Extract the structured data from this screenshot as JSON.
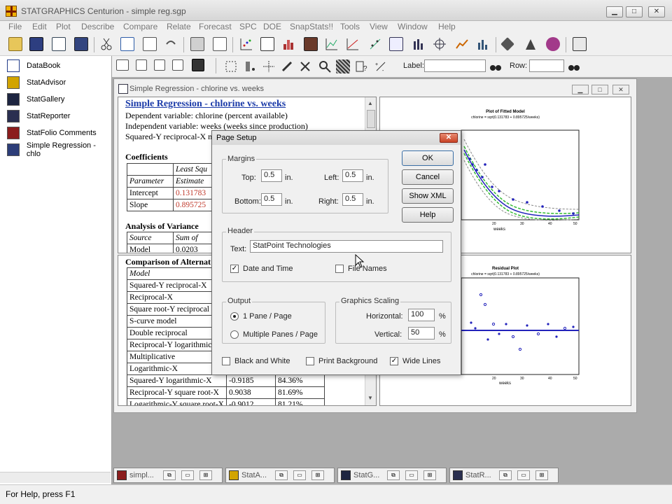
{
  "app": {
    "title": "STATGRAPHICS Centurion - simple reg.sgp"
  },
  "window_buttons": {
    "minimize": "▁",
    "maximize": "□",
    "close": "✕"
  },
  "menu": [
    "File",
    "Edit",
    "Plot",
    "Describe",
    "Compare",
    "Relate",
    "Forecast",
    "SPC",
    "DOE",
    "SnapStats!!",
    "Tools",
    "View",
    "Window",
    "Help"
  ],
  "toolbar2": {
    "label_text": "Label:",
    "label_value": "",
    "row_text": "Row:",
    "row_value": ""
  },
  "left_panel": {
    "items": [
      "DataBook",
      "StatAdvisor",
      "StatGallery",
      "StatReporter",
      "StatFolio Comments",
      "Simple Regression - chlo"
    ]
  },
  "child_window": {
    "title": "Simple Regression - chlorine vs. weeks"
  },
  "report": {
    "heading": "Simple Regression - chlorine vs. weeks",
    "lines": [
      "Dependent variable: chlorine (percent available)",
      "Independent variable: weeks (weeks since production)",
      "Squared-Y reciprocal-X m"
    ],
    "coefficients_title": "Coefficients",
    "coef_header1": [
      "",
      "Least Squ"
    ],
    "coef_header2": [
      "Parameter",
      "Estimate"
    ],
    "coef_rows": [
      [
        "Intercept",
        "0.131783"
      ],
      [
        "Slope",
        "0.895725"
      ]
    ],
    "anova_title": "Analysis of Variance",
    "anova_header": [
      "Source",
      "Sum of"
    ],
    "anova_rows": [
      [
        "Model",
        "0.0203"
      ]
    ]
  },
  "comparison": {
    "title": "Comparison of Alternat",
    "header": "Model",
    "rows": [
      [
        "Squared-Y reciprocal-X",
        "",
        ""
      ],
      [
        "Reciprocal-X",
        "",
        ""
      ],
      [
        "Square root-Y reciprocal",
        "",
        ""
      ],
      [
        "S-curve model",
        "",
        ""
      ],
      [
        "Double reciprocal",
        "",
        ""
      ],
      [
        "Reciprocal-Y logarithmic",
        "",
        ""
      ],
      [
        "Multiplicative",
        "",
        ""
      ],
      [
        "Logarithmic-X",
        "",
        ""
      ],
      [
        "Squared-Y logarithmic-X",
        "-0.9185",
        "84.36%"
      ],
      [
        "Reciprocal-Y square root-X",
        "0.9038",
        "81.69%"
      ],
      [
        "Logarithmic-Y square root-X",
        "-0.9012",
        "81.21%"
      ]
    ]
  },
  "graph1": {
    "title": "Plot of Fitted Model",
    "subtitle": "chlorine = sqrt(0.131783 + 0.895725/weeks)",
    "xlabel": "weeks"
  },
  "graph2": {
    "title": "Residual Plot",
    "subtitle": "chlorine = sqrt(0.131783 + 0.895725/weeks)",
    "xlabel": "weeks"
  },
  "dialog": {
    "title": "Page Setup",
    "close": "✕",
    "margins_label": "Margins",
    "top_label": "Top:",
    "top_value": "0.5",
    "left_label": "Left:",
    "left_value": "0.5",
    "bottom_label": "Bottom:",
    "bottom_value": "0.5",
    "right_label": "Right:",
    "right_value": "0.5",
    "unit": "in.",
    "header_label": "Header",
    "text_label": "Text:",
    "text_value": "StatPoint Technologies",
    "date_time_label": "Date and Time",
    "date_time_checked": true,
    "file_names_label": "File Names",
    "file_names_checked": false,
    "output_label": "Output",
    "one_pane_label": "1 Pane / Page",
    "multi_pane_label": "Multiple Panes / Page",
    "scaling_label": "Graphics Scaling",
    "horizontal_label": "Horizontal:",
    "horizontal_value": "100",
    "vertical_label": "Vertical:",
    "vertical_value": "50",
    "percent": "%",
    "bw_label": "Black and White",
    "print_bg_label": "Print Background",
    "wide_lines_label": "Wide Lines",
    "ok": "OK",
    "cancel": "Cancel",
    "show_xml": "Show XML",
    "help": "Help"
  },
  "tabs": [
    {
      "label": "simpl..."
    },
    {
      "label": "StatA..."
    },
    {
      "label": "StatG..."
    },
    {
      "label": "StatR..."
    }
  ],
  "status": {
    "text": "For Help, press F1"
  }
}
